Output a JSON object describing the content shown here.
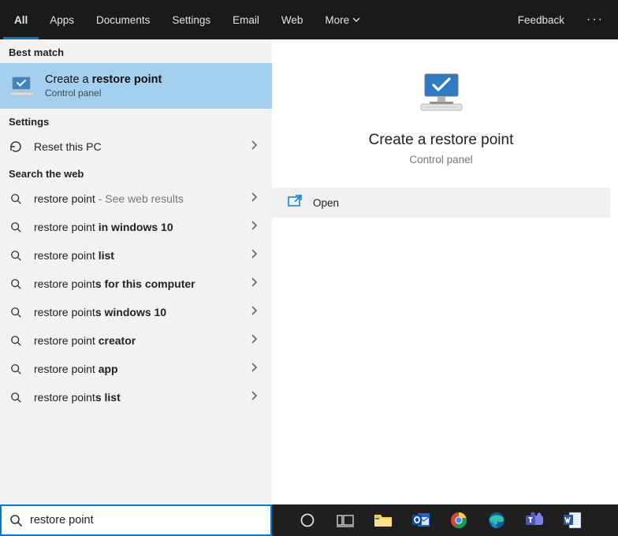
{
  "tabs": {
    "items": [
      "All",
      "Apps",
      "Documents",
      "Settings",
      "Email",
      "Web",
      "More"
    ],
    "feedback": "Feedback"
  },
  "left": {
    "best_match_header": "Best match",
    "best": {
      "title_pre": "Create a ",
      "title_bold": "restore point",
      "sub": "Control panel"
    },
    "settings_header": "Settings",
    "reset_pc": "Reset this PC",
    "web_header": "Search the web",
    "web": [
      {
        "pre": "restore point",
        "bold": "",
        "suffix": " - See web results"
      },
      {
        "pre": "restore point ",
        "bold": "in windows 10",
        "suffix": ""
      },
      {
        "pre": "restore point ",
        "bold": "list",
        "suffix": ""
      },
      {
        "pre": "restore point",
        "bold": "s for this computer",
        "suffix": ""
      },
      {
        "pre": "restore point",
        "bold": "s windows 10",
        "suffix": ""
      },
      {
        "pre": "restore point ",
        "bold": "creator",
        "suffix": ""
      },
      {
        "pre": "restore point ",
        "bold": "app",
        "suffix": ""
      },
      {
        "pre": "restore point",
        "bold": "s list",
        "suffix": ""
      }
    ]
  },
  "right": {
    "title": "Create a restore point",
    "sub": "Control panel",
    "open": "Open"
  },
  "search": {
    "value": "restore point"
  }
}
